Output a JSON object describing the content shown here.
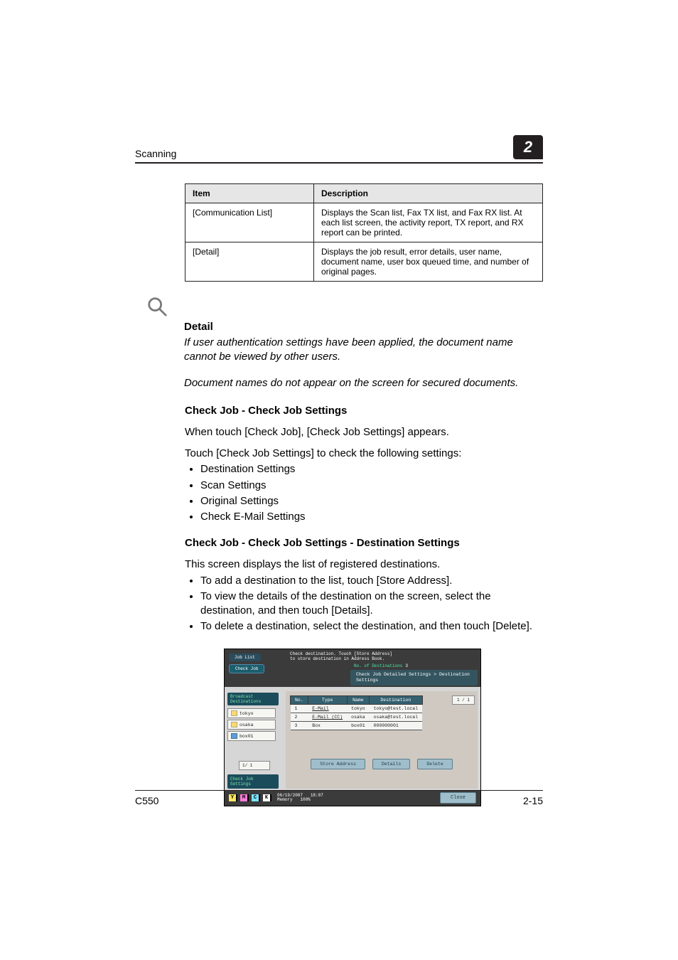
{
  "header": {
    "section_label": "Scanning",
    "chapter_number": "2"
  },
  "table": {
    "headers": {
      "item": "Item",
      "description": "Description"
    },
    "rows": [
      {
        "item": "[Communication List]",
        "description": "Displays the Scan list, Fax TX list, and Fax RX list. At each list screen, the activity report, TX report, and RX report can be printed."
      },
      {
        "item": "[Detail]",
        "description": "Displays the job result, error details, user name, document name, user box queued time, and number of original pages."
      }
    ]
  },
  "detail": {
    "heading": "Detail",
    "para1": "If user authentication settings have been applied, the document name cannot be viewed by other users.",
    "para2": "Document names do not appear on the screen for secured documents."
  },
  "section_a": {
    "heading": "Check Job - Check Job Settings",
    "p1": "When touch [Check Job], [Check Job Settings] appears.",
    "p2": "Touch [Check Job Settings] to check the following settings:",
    "bullets": [
      "Destination Settings",
      "Scan Settings",
      "Original Settings",
      "Check E-Mail Settings"
    ]
  },
  "section_b": {
    "heading": "Check Job - Check Job Settings - Destination Settings",
    "p1": "This screen displays the list of registered destinations.",
    "bullets": [
      "To add a destination to the list, touch [Store Address].",
      "To view the details of the destination on the screen, select the destination, and then touch [Details].",
      "To delete a destination, select the destination, and then touch [Delete]."
    ]
  },
  "screenshot": {
    "tabs": {
      "job_list": "Job List",
      "check_job": "Check Job"
    },
    "prompt_l1": "Check destination. Touch [Store Address]",
    "prompt_l2": "to store destination in Address Book.",
    "dest_label": "No. of Destinations",
    "dest_count": "3",
    "breadcrumb": "Check Job Detailed Settings > Destination Settings",
    "left_header": "Broadcast Destinations",
    "group_items": [
      {
        "label": "tokyo",
        "icon": "mail"
      },
      {
        "label": "osaka",
        "icon": "mail"
      },
      {
        "label": "box01",
        "icon": "box"
      }
    ],
    "page_left": "1/  1",
    "check_settings": "Check Job Settings",
    "table": {
      "headers": {
        "no": "No.",
        "type": "Type",
        "name": "Name",
        "dest": "Destination"
      },
      "rows": [
        {
          "no": "1",
          "type": "E-Mail",
          "name": "tokyo",
          "dest": "tokyo@test.local"
        },
        {
          "no": "2",
          "type": "E-Mail (CC)",
          "name": "osaka",
          "dest": "osaka@test.local"
        },
        {
          "no": "3",
          "type": "Box",
          "name": "box01",
          "dest": "000000001"
        }
      ]
    },
    "page_right": "1 / 1",
    "buttons": {
      "store": "Store Address",
      "details": "Details",
      "delete": "Delete",
      "close": "Close"
    },
    "status": {
      "date": "06/19/2007",
      "time": "18:07",
      "memory_label": "Memory",
      "memory_value": "100%"
    }
  },
  "footer": {
    "model": "C550",
    "page_number": "2-15"
  }
}
